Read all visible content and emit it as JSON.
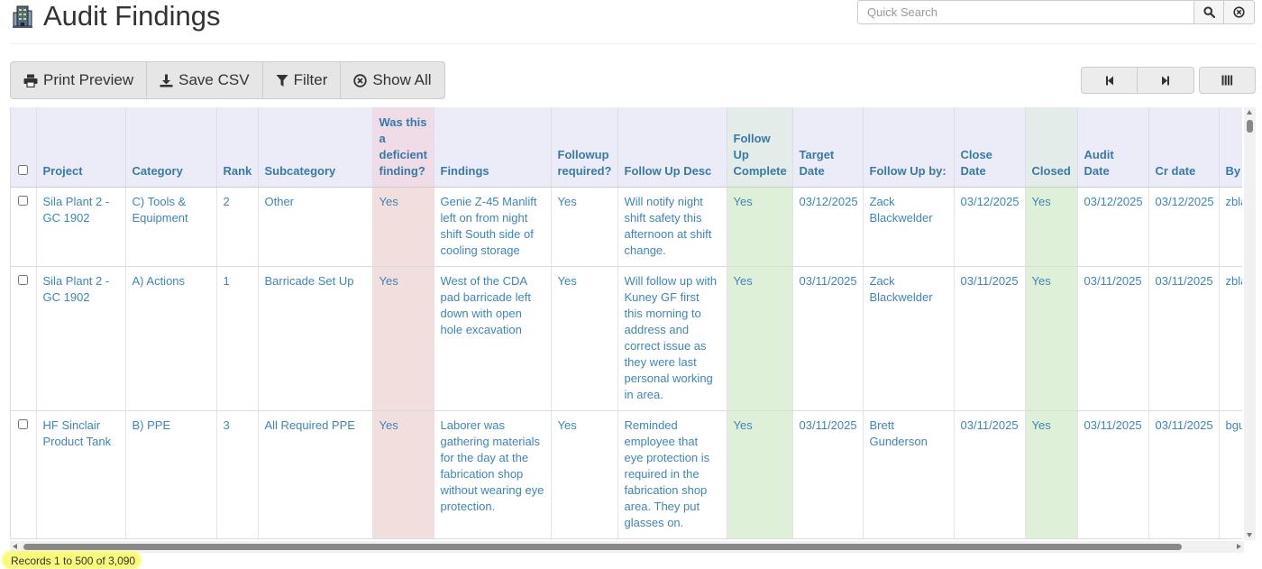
{
  "header": {
    "title": "Audit Findings",
    "icon": "building-icon"
  },
  "search": {
    "placeholder": "Quick Search",
    "value": ""
  },
  "toolbar": {
    "print_label": "Print Preview",
    "csv_label": "Save CSV",
    "filter_label": "Filter",
    "showall_label": "Show All"
  },
  "pager": {
    "first_icon": "first-page-icon",
    "last_icon": "last-page-icon",
    "columns_icon": "columns-icon"
  },
  "table": {
    "columns": [
      "Project",
      "Category",
      "Rank",
      "Subcategory",
      "Was this a deficient finding?",
      "Findings",
      "Followup required?",
      "Follow Up Desc",
      "Follow Up Complete",
      "Target Date",
      "Follow Up by:",
      "Close Date",
      "Closed",
      "Audit Date",
      "Cr date",
      "By"
    ],
    "rows": [
      {
        "project": "Sila Plant 2 - GC 1902",
        "category": "C) Tools & Equipment",
        "rank": "2",
        "subcategory": "Other",
        "deficient": "Yes",
        "findings": "Genie Z-45 Manlift left on from night shift South side of cooling storage",
        "followup_required": "Yes",
        "followup_desc": "Will notify night shift safety this afternoon at shift change.",
        "followup_complete": "Yes",
        "target_date": "03/12/2025",
        "followup_by": "Zack Blackwelder",
        "close_date": "03/12/2025",
        "closed": "Yes",
        "audit_date": "03/12/2025",
        "cr_date": "03/12/2025",
        "by": "zbla"
      },
      {
        "project": "Sila Plant 2 - GC 1902",
        "category": "A) Actions",
        "rank": "1",
        "subcategory": "Barricade Set Up",
        "deficient": "Yes",
        "findings": "West of the CDA pad barricade left down with open hole excavation",
        "followup_required": "Yes",
        "followup_desc": "Will follow up with Kuney GF first this morning to address and correct issue as they were last personal working in area.",
        "followup_complete": "Yes",
        "target_date": "03/11/2025",
        "followup_by": "Zack Blackwelder",
        "close_date": "03/11/2025",
        "closed": "Yes",
        "audit_date": "03/11/2025",
        "cr_date": "03/11/2025",
        "by": "zbla"
      },
      {
        "project": "HF Sinclair Product Tank",
        "category": "B) PPE",
        "rank": "3",
        "subcategory": "All Required PPE",
        "deficient": "Yes",
        "findings": "Laborer was gathering materials for the day at the fabrication shop without wearing eye protection.",
        "followup_required": "Yes",
        "followup_desc": "Reminded employee that eye protection is required in the fabrication shop area. They put glasses on.",
        "followup_complete": "Yes",
        "target_date": "03/11/2025",
        "followup_by": "Brett Gunderson",
        "close_date": "03/11/2025",
        "closed": "Yes",
        "audit_date": "03/11/2025",
        "cr_date": "03/11/2025",
        "by": "bgur"
      }
    ]
  },
  "footer": {
    "records_text": "Records 1 to 500 of 3,090"
  }
}
